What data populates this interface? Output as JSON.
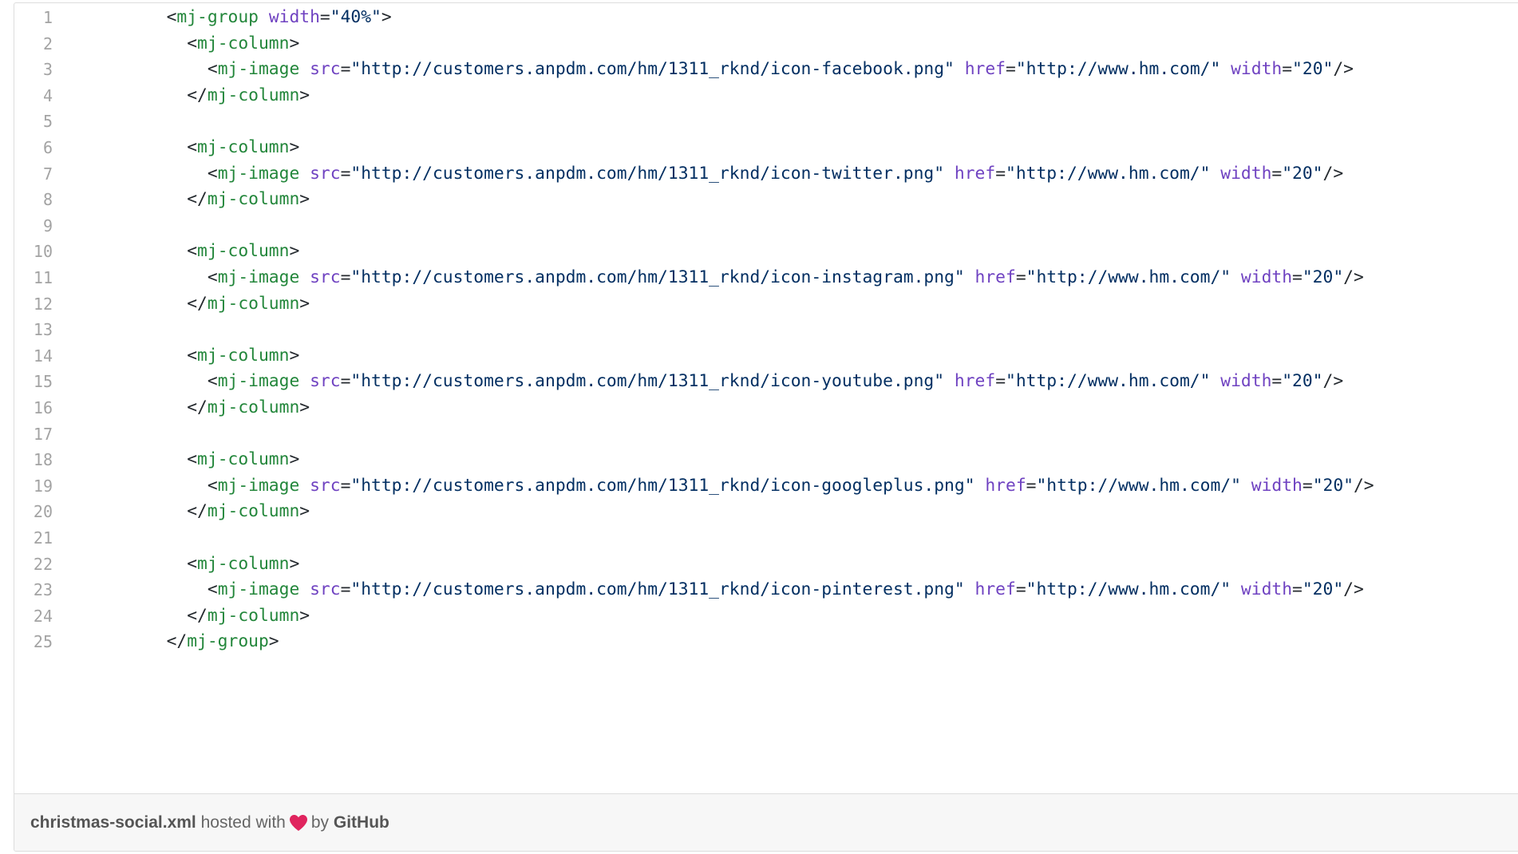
{
  "gist": {
    "lines": [
      {
        "number": "1",
        "tokens": [
          [
            "p",
            "        <"
          ],
          [
            "t",
            "mj-group"
          ],
          [
            "p",
            " "
          ],
          [
            "a",
            "width"
          ],
          [
            "p",
            "="
          ],
          [
            "s",
            "\"40%\""
          ],
          [
            "p",
            ">"
          ]
        ]
      },
      {
        "number": "2",
        "tokens": [
          [
            "p",
            "          <"
          ],
          [
            "t",
            "mj-column"
          ],
          [
            "p",
            ">"
          ]
        ]
      },
      {
        "number": "3",
        "tokens": [
          [
            "p",
            "            <"
          ],
          [
            "t",
            "mj-image"
          ],
          [
            "p",
            " "
          ],
          [
            "a",
            "src"
          ],
          [
            "p",
            "="
          ],
          [
            "s",
            "\"http://customers.anpdm.com/hm/1311_rknd/icon-facebook.png\""
          ],
          [
            "p",
            " "
          ],
          [
            "a",
            "href"
          ],
          [
            "p",
            "="
          ],
          [
            "s",
            "\"http://www.hm.com/\""
          ],
          [
            "p",
            " "
          ],
          [
            "a",
            "width"
          ],
          [
            "p",
            "="
          ],
          [
            "s",
            "\"20\""
          ],
          [
            "p",
            "/>"
          ]
        ]
      },
      {
        "number": "4",
        "tokens": [
          [
            "p",
            "          </"
          ],
          [
            "t",
            "mj-column"
          ],
          [
            "p",
            ">"
          ]
        ]
      },
      {
        "number": "5",
        "tokens": []
      },
      {
        "number": "6",
        "tokens": [
          [
            "p",
            "          <"
          ],
          [
            "t",
            "mj-column"
          ],
          [
            "p",
            ">"
          ]
        ]
      },
      {
        "number": "7",
        "tokens": [
          [
            "p",
            "            <"
          ],
          [
            "t",
            "mj-image"
          ],
          [
            "p",
            " "
          ],
          [
            "a",
            "src"
          ],
          [
            "p",
            "="
          ],
          [
            "s",
            "\"http://customers.anpdm.com/hm/1311_rknd/icon-twitter.png\""
          ],
          [
            "p",
            " "
          ],
          [
            "a",
            "href"
          ],
          [
            "p",
            "="
          ],
          [
            "s",
            "\"http://www.hm.com/\""
          ],
          [
            "p",
            " "
          ],
          [
            "a",
            "width"
          ],
          [
            "p",
            "="
          ],
          [
            "s",
            "\"20\""
          ],
          [
            "p",
            "/>"
          ]
        ]
      },
      {
        "number": "8",
        "tokens": [
          [
            "p",
            "          </"
          ],
          [
            "t",
            "mj-column"
          ],
          [
            "p",
            ">"
          ]
        ]
      },
      {
        "number": "9",
        "tokens": []
      },
      {
        "number": "10",
        "tokens": [
          [
            "p",
            "          <"
          ],
          [
            "t",
            "mj-column"
          ],
          [
            "p",
            ">"
          ]
        ]
      },
      {
        "number": "11",
        "tokens": [
          [
            "p",
            "            <"
          ],
          [
            "t",
            "mj-image"
          ],
          [
            "p",
            " "
          ],
          [
            "a",
            "src"
          ],
          [
            "p",
            "="
          ],
          [
            "s",
            "\"http://customers.anpdm.com/hm/1311_rknd/icon-instagram.png\""
          ],
          [
            "p",
            " "
          ],
          [
            "a",
            "href"
          ],
          [
            "p",
            "="
          ],
          [
            "s",
            "\"http://www.hm.com/\""
          ],
          [
            "p",
            " "
          ],
          [
            "a",
            "width"
          ],
          [
            "p",
            "="
          ],
          [
            "s",
            "\"20\""
          ],
          [
            "p",
            "/>"
          ]
        ]
      },
      {
        "number": "12",
        "tokens": [
          [
            "p",
            "          </"
          ],
          [
            "t",
            "mj-column"
          ],
          [
            "p",
            ">"
          ]
        ]
      },
      {
        "number": "13",
        "tokens": []
      },
      {
        "number": "14",
        "tokens": [
          [
            "p",
            "          <"
          ],
          [
            "t",
            "mj-column"
          ],
          [
            "p",
            ">"
          ]
        ]
      },
      {
        "number": "15",
        "tokens": [
          [
            "p",
            "            <"
          ],
          [
            "t",
            "mj-image"
          ],
          [
            "p",
            " "
          ],
          [
            "a",
            "src"
          ],
          [
            "p",
            "="
          ],
          [
            "s",
            "\"http://customers.anpdm.com/hm/1311_rknd/icon-youtube.png\""
          ],
          [
            "p",
            " "
          ],
          [
            "a",
            "href"
          ],
          [
            "p",
            "="
          ],
          [
            "s",
            "\"http://www.hm.com/\""
          ],
          [
            "p",
            " "
          ],
          [
            "a",
            "width"
          ],
          [
            "p",
            "="
          ],
          [
            "s",
            "\"20\""
          ],
          [
            "p",
            "/>"
          ]
        ]
      },
      {
        "number": "16",
        "tokens": [
          [
            "p",
            "          </"
          ],
          [
            "t",
            "mj-column"
          ],
          [
            "p",
            ">"
          ]
        ]
      },
      {
        "number": "17",
        "tokens": []
      },
      {
        "number": "18",
        "tokens": [
          [
            "p",
            "          <"
          ],
          [
            "t",
            "mj-column"
          ],
          [
            "p",
            ">"
          ]
        ]
      },
      {
        "number": "19",
        "tokens": [
          [
            "p",
            "            <"
          ],
          [
            "t",
            "mj-image"
          ],
          [
            "p",
            " "
          ],
          [
            "a",
            "src"
          ],
          [
            "p",
            "="
          ],
          [
            "s",
            "\"http://customers.anpdm.com/hm/1311_rknd/icon-googleplus.png\""
          ],
          [
            "p",
            " "
          ],
          [
            "a",
            "href"
          ],
          [
            "p",
            "="
          ],
          [
            "s",
            "\"http://www.hm.com/\""
          ],
          [
            "p",
            " "
          ],
          [
            "a",
            "width"
          ],
          [
            "p",
            "="
          ],
          [
            "s",
            "\"20\""
          ],
          [
            "p",
            "/>"
          ]
        ]
      },
      {
        "number": "20",
        "tokens": [
          [
            "p",
            "          </"
          ],
          [
            "t",
            "mj-column"
          ],
          [
            "p",
            ">"
          ]
        ]
      },
      {
        "number": "21",
        "tokens": []
      },
      {
        "number": "22",
        "tokens": [
          [
            "p",
            "          <"
          ],
          [
            "t",
            "mj-column"
          ],
          [
            "p",
            ">"
          ]
        ]
      },
      {
        "number": "23",
        "tokens": [
          [
            "p",
            "            <"
          ],
          [
            "t",
            "mj-image"
          ],
          [
            "p",
            " "
          ],
          [
            "a",
            "src"
          ],
          [
            "p",
            "="
          ],
          [
            "s",
            "\"http://customers.anpdm.com/hm/1311_rknd/icon-pinterest.png\""
          ],
          [
            "p",
            " "
          ],
          [
            "a",
            "href"
          ],
          [
            "p",
            "="
          ],
          [
            "s",
            "\"http://www.hm.com/\""
          ],
          [
            "p",
            " "
          ],
          [
            "a",
            "width"
          ],
          [
            "p",
            "="
          ],
          [
            "s",
            "\"20\""
          ],
          [
            "p",
            "/>"
          ]
        ]
      },
      {
        "number": "24",
        "tokens": [
          [
            "p",
            "          </"
          ],
          [
            "t",
            "mj-column"
          ],
          [
            "p",
            ">"
          ]
        ]
      },
      {
        "number": "25",
        "tokens": [
          [
            "p",
            "        </"
          ],
          [
            "t",
            "mj-group"
          ],
          [
            "p",
            ">"
          ]
        ]
      }
    ]
  },
  "footer": {
    "filename": "christmas-social.xml",
    "hosted_with": "hosted with",
    "heart_icon": "heart-icon",
    "by": "by",
    "host": "GitHub"
  },
  "colors": {
    "tag": "#22863a",
    "attribute": "#6f42c1",
    "string": "#032f62",
    "line_number": "#a3a3a3",
    "heart": "#e0245e"
  }
}
